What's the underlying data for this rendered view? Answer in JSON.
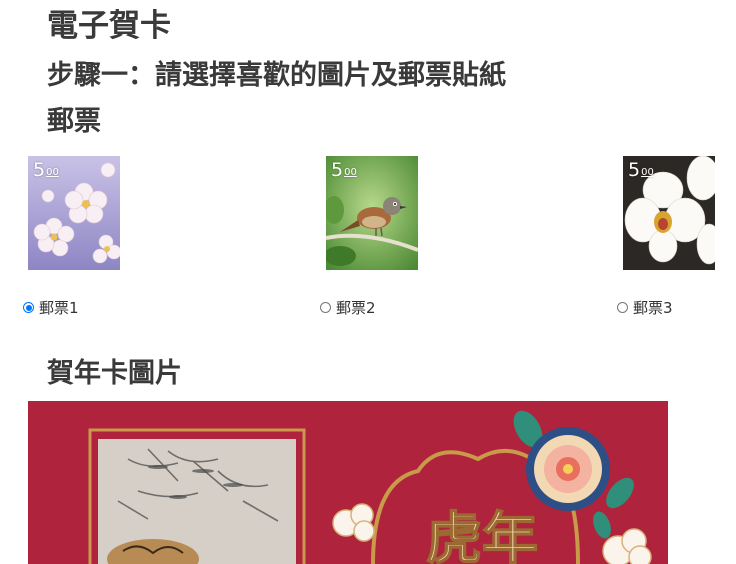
{
  "page": {
    "title": "電子賀卡",
    "step_title": "步驟一：請選擇喜歡的圖片及郵票貼紙",
    "stamps_heading": "郵票",
    "card_heading": "賀年卡圖片"
  },
  "stamps": [
    {
      "label": "郵票1",
      "value_main": "5",
      "value_cents": "00",
      "subject": "cherry-blossom",
      "selected": true
    },
    {
      "label": "郵票2",
      "value_main": "5",
      "value_cents": "00",
      "subject": "bird",
      "selected": false
    },
    {
      "label": "郵票3",
      "value_main": "5",
      "value_cents": "00",
      "subject": "orchid",
      "selected": false
    }
  ],
  "card": {
    "text": "虎年",
    "background_color": "#b0233c",
    "frame_color": "#c99a4a"
  },
  "colors": {
    "radio_selected": "#0075ff",
    "heading": "#3a3a3a"
  }
}
